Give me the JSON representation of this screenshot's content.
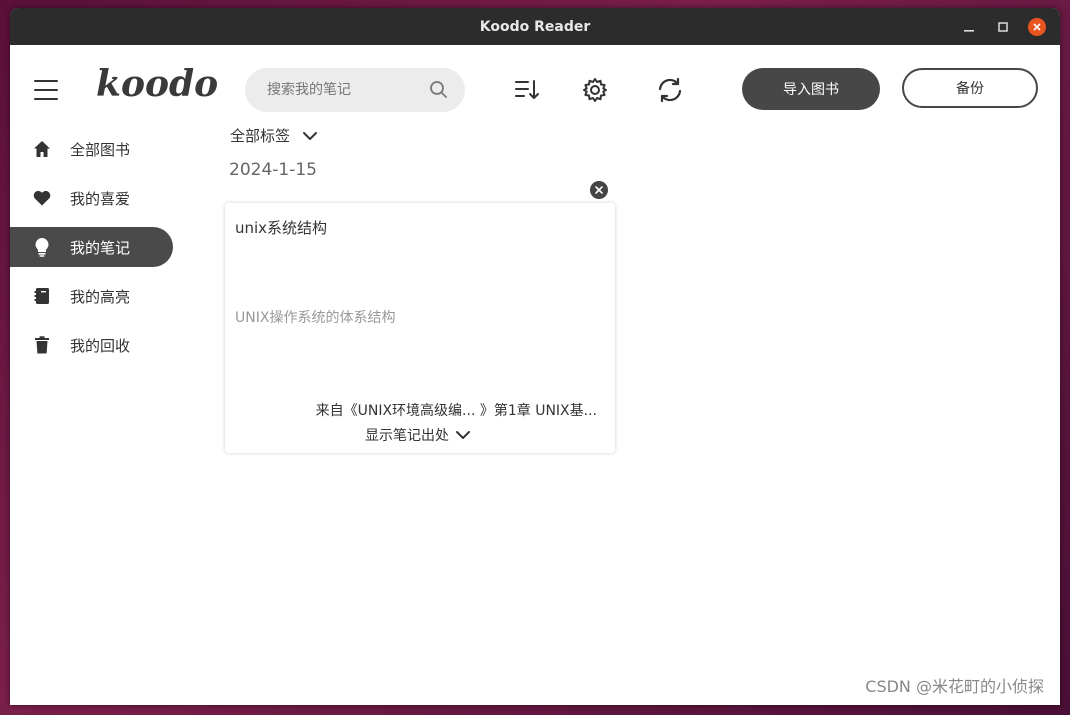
{
  "window": {
    "title": "Koodo Reader"
  },
  "header": {
    "logo_text": "koodo",
    "search_placeholder": "搜索我的笔记",
    "import_label": "导入图书",
    "backup_label": "备份"
  },
  "sidebar": {
    "items": [
      {
        "label": "全部图书",
        "icon": "home-icon",
        "active": false
      },
      {
        "label": "我的喜爱",
        "icon": "heart-icon",
        "active": false
      },
      {
        "label": "我的笔记",
        "icon": "bulb-icon",
        "active": true
      },
      {
        "label": "我的高亮",
        "icon": "highlight-book-icon",
        "active": false
      },
      {
        "label": "我的回收",
        "icon": "trash-icon",
        "active": false
      }
    ]
  },
  "main": {
    "tag_filter_label": "全部标签",
    "date": "2024-1-15",
    "note": {
      "title": "unix系统结构",
      "quote": "UNIX操作系统的体系结构",
      "source": "来自《UNIX环境高级编... 》第1章 UNIX基...",
      "show_source_label": "显示笔记出处"
    }
  },
  "watermark": "CSDN @米花町的小侦探",
  "colors": {
    "titlebar": "#2c2c2c",
    "active_item": "#4a4a4a",
    "close_button": "#e9541f",
    "desktop": "#6a1a42"
  }
}
